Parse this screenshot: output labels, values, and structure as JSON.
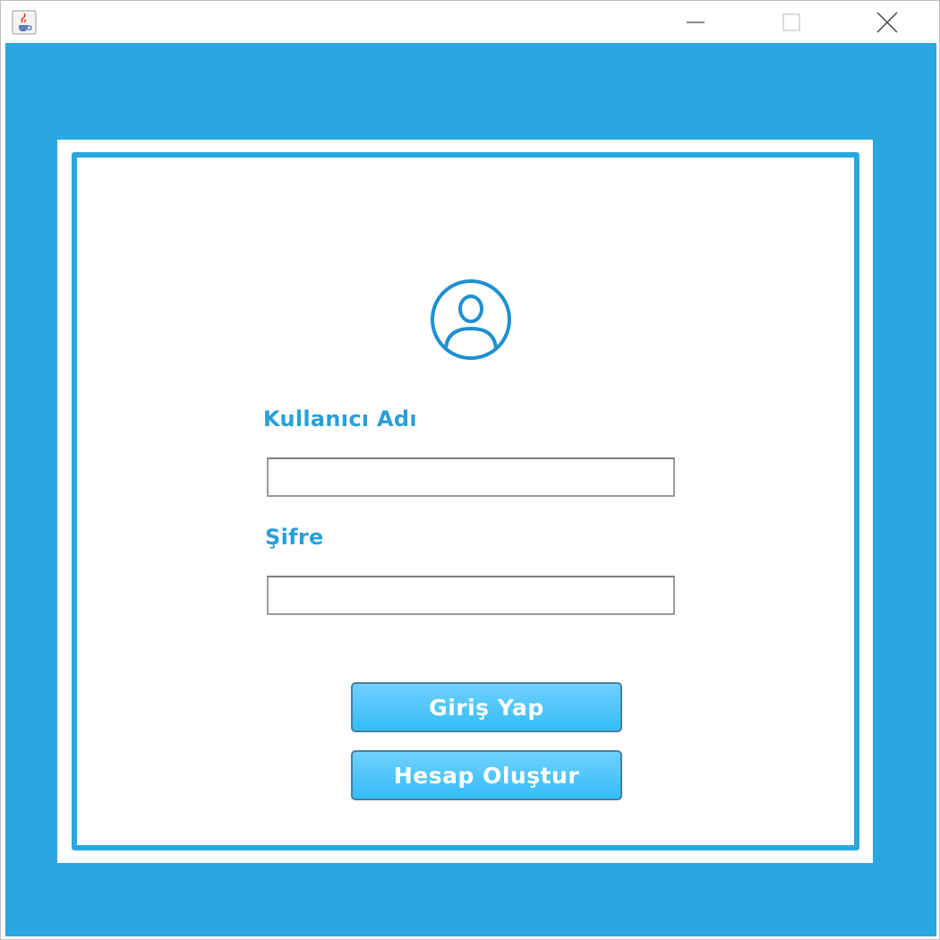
{
  "titlebar": {
    "icon": "java-cup-icon",
    "controls": [
      "minimize-icon",
      "maximize-icon",
      "close-icon"
    ]
  },
  "login": {
    "avatar_icon": "user-circle-icon",
    "username_label": "Kullanıcı Adı",
    "username_value": "",
    "password_label": "Şifre",
    "password_value": "",
    "login_button": "Giriş Yap",
    "register_button": "Hesap Oluştur"
  },
  "colors": {
    "accent": "#29a7e1",
    "label": "#2a9fd8",
    "button": "#42c3f7"
  }
}
